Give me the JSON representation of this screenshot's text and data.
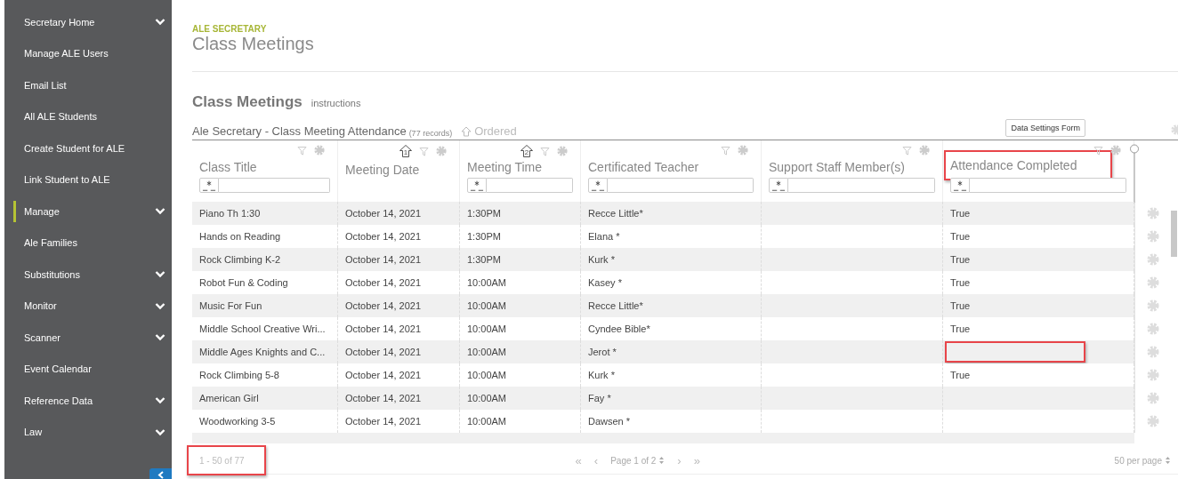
{
  "sidebar": {
    "items": [
      {
        "label": "Secretary Home",
        "expandable": true,
        "selected": false
      },
      {
        "label": "Manage ALE Users",
        "expandable": false,
        "selected": false
      },
      {
        "label": "Email List",
        "expandable": false,
        "selected": false
      },
      {
        "label": "All ALE Students",
        "expandable": false,
        "selected": false
      },
      {
        "label": "Create Student for ALE",
        "expandable": false,
        "selected": false
      },
      {
        "label": "Link Student to ALE",
        "expandable": false,
        "selected": false
      },
      {
        "label": "Manage",
        "expandable": true,
        "selected": true
      },
      {
        "label": "Ale Families",
        "expandable": false,
        "selected": false
      },
      {
        "label": "Substitutions",
        "expandable": true,
        "selected": false
      },
      {
        "label": "Monitor",
        "expandable": true,
        "selected": false
      },
      {
        "label": "Scanner",
        "expandable": true,
        "selected": false
      },
      {
        "label": "Event Calendar",
        "expandable": false,
        "selected": false
      },
      {
        "label": "Reference Data",
        "expandable": true,
        "selected": false
      },
      {
        "label": "Law",
        "expandable": true,
        "selected": false
      }
    ]
  },
  "header": {
    "eyebrow": "ALE SECRETARY",
    "title": "Class Meetings"
  },
  "section": {
    "title": "Class Meetings",
    "link": "instructions"
  },
  "table": {
    "title": "Ale Secretary - Class Meeting Attendance",
    "record_count": "(77 records)",
    "order_label": "Ordered",
    "settings_button": "Data Settings Form",
    "columns": [
      {
        "label": "Class Title",
        "filter_field": true,
        "highlighted": false
      },
      {
        "label": "Meeting Date",
        "sort": "1",
        "filter_field": false,
        "highlighted": false
      },
      {
        "label": "Meeting Time",
        "sort": "2",
        "filter_field": true,
        "highlighted": false
      },
      {
        "label": "Certificated Teacher",
        "filter_field": true,
        "highlighted": false
      },
      {
        "label": "Support Staff Member(s)",
        "filter_field": true,
        "highlighted": false
      },
      {
        "label": "Attendance Completed",
        "filter_field": true,
        "highlighted": true
      }
    ],
    "rows": [
      {
        "class_title": "Piano Th 1:30",
        "meeting_date": "October 14, 2021",
        "meeting_time": "1:30PM",
        "certificated_teacher": "Recce Little*",
        "attendance_completed": "True",
        "highlighted": false
      },
      {
        "class_title": "Hands on Reading",
        "meeting_date": "October 14, 2021",
        "meeting_time": "1:30PM",
        "certificated_teacher": "Elana *",
        "attendance_completed": "True",
        "highlighted": false
      },
      {
        "class_title": "Rock Climbing K-2",
        "meeting_date": "October 14, 2021",
        "meeting_time": "1:30PM",
        "certificated_teacher": "Kurk *",
        "attendance_completed": "True",
        "highlighted": false
      },
      {
        "class_title": "Robot Fun & Coding",
        "meeting_date": "October 14, 2021",
        "meeting_time": "10:00AM",
        "certificated_teacher": "Kasey *",
        "attendance_completed": "True",
        "highlighted": false
      },
      {
        "class_title": "Music For Fun",
        "meeting_date": "October 14, 2021",
        "meeting_time": "10:00AM",
        "certificated_teacher": "Recce Little*",
        "attendance_completed": "True",
        "highlighted": false
      },
      {
        "class_title": "Middle School Creative Wri...",
        "meeting_date": "October 14, 2021",
        "meeting_time": "10:00AM",
        "certificated_teacher": "Cyndee Bible*",
        "attendance_completed": "True",
        "highlighted": false
      },
      {
        "class_title": "Middle Ages Knights and C...",
        "meeting_date": "October 14, 2021",
        "meeting_time": "10:00AM",
        "certificated_teacher": "Jerot *",
        "highlighted": true
      },
      {
        "class_title": "Rock Climbing 5-8",
        "meeting_date": "October 14, 2021",
        "meeting_time": "10:00AM",
        "certificated_teacher": "Kurk *",
        "attendance_completed": "True",
        "highlighted": false
      },
      {
        "class_title": "American Girl",
        "meeting_date": "October 14, 2021",
        "meeting_time": "10:00AM",
        "certificated_teacher": "Fay *",
        "highlighted": false
      },
      {
        "class_title": "Woodworking 3-5",
        "meeting_date": "October 14, 2021",
        "meeting_time": "10:00AM",
        "certificated_teacher": "Dawsen *",
        "highlighted": false
      }
    ],
    "footer": {
      "range": "1 - 50 of 77",
      "range_highlighted": true,
      "first": "«",
      "prev": "‹",
      "page": "Page 1 of 2",
      "next": "›",
      "last": "»",
      "per_page": "50 per page"
    }
  }
}
